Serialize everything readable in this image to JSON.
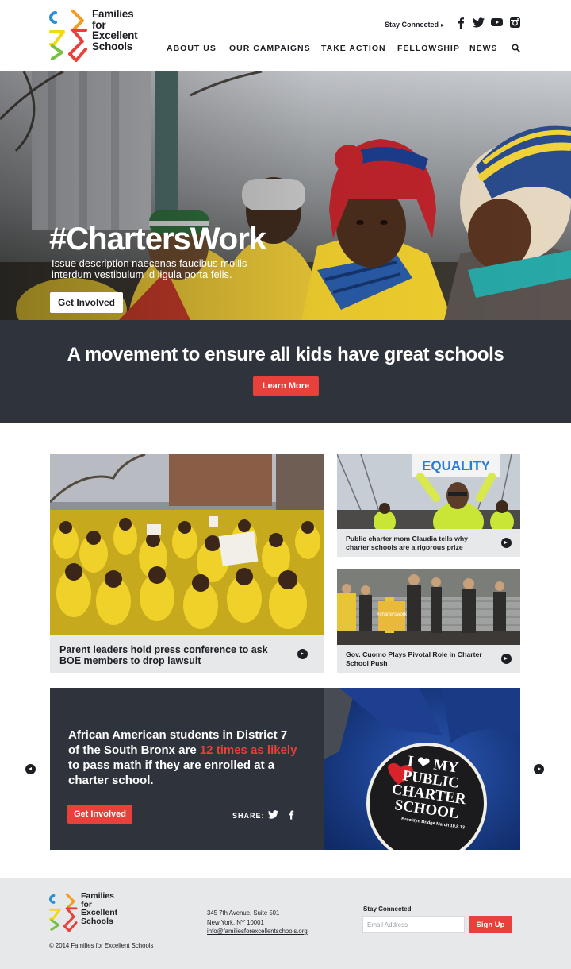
{
  "brand": {
    "logo_line1": "Families",
    "logo_line2": "for",
    "logo_line3": "Excellent",
    "logo_line4": "Schools",
    "colors": {
      "red": "#e8403a",
      "dark": "#2f333b",
      "yellow": "#f5d90a",
      "green": "#76c043",
      "blue": "#2a8fd6",
      "orange": "#f39c1d"
    }
  },
  "header": {
    "stay_connected": "Stay Connected",
    "social_icons": [
      "facebook-icon",
      "twitter-icon",
      "youtube-icon",
      "instagram-icon"
    ],
    "nav": [
      "ABOUT US",
      "OUR CAMPAIGNS",
      "TAKE ACTION",
      "FELLOWSHIP",
      "NEWS"
    ]
  },
  "hero": {
    "title": "#ChartersWork",
    "description": "Issue description naecenas faucibus mollis interdum vestibulum id ligula porta felis.",
    "button": "Get Involved"
  },
  "band": {
    "title": "A movement to ensure all kids have great schools",
    "button": "Learn More"
  },
  "cards": [
    {
      "caption": "Parent leaders hold press conference to ask BOE members to drop lawsuit"
    },
    {
      "caption": "Public charter mom Claudia tells why charter schools are a rigorous prize",
      "sign_text": "EQUALITY"
    },
    {
      "caption": "Gov. Cuomo Plays Pivotal Role in Charter School Push",
      "podium_text": "#charterswork"
    }
  ],
  "carousel": {
    "stat_before": "African American students in District 7 of the South Bronx are ",
    "stat_highlight": "12 times as likely",
    "stat_after": " to pass math if they are enrolled at a charter school.",
    "button": "Get Involved",
    "share_label": "SHARE:",
    "pin_text": "I ❤ MY PUBLIC CHARTER SCHOOL",
    "pin_sub": "Brooklyn Bridge March 10.8.13"
  },
  "footer": {
    "logo_line1": "Families",
    "logo_line2": "for",
    "logo_line3": "Excellent",
    "logo_line4": "Schools",
    "copyright": "© 2014 Families for Excellent Schools",
    "address_line1": "345 7th Avenue, Suite 501",
    "address_line2": "New York, NY 10001",
    "email": "info@familiesforexcellentschools.org",
    "stay_connected": "Stay Connected",
    "email_placeholder": "Email Address",
    "signup": "Sign Up"
  }
}
